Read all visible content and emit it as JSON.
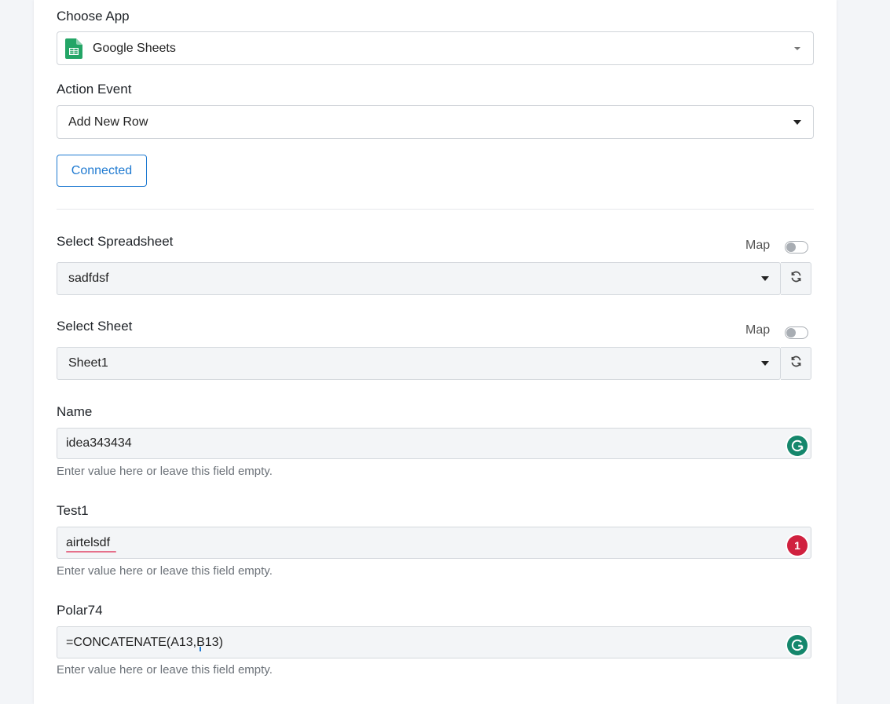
{
  "app_section": {
    "choose_app_label": "Choose App",
    "choose_app_value": "Google Sheets",
    "app_icon": "google-sheets-icon",
    "action_event_label": "Action Event",
    "action_event_value": "Add New Row",
    "connected_label": "Connected"
  },
  "spreadsheet": {
    "label": "Select Spreadsheet",
    "map_label": "Map",
    "map_on": false,
    "value": "sadfdsf",
    "refresh_icon": "refresh-icon"
  },
  "sheet": {
    "label": "Select Sheet",
    "map_label": "Map",
    "map_on": false,
    "value": "Sheet1",
    "refresh_icon": "refresh-icon"
  },
  "fields": [
    {
      "label": "Name",
      "value": "idea343434",
      "help": "Enter value here or leave this field empty.",
      "badge": "grammarly-icon"
    },
    {
      "label": "Test1",
      "value": "airtelsdf",
      "help": "Enter value here or leave this field empty.",
      "badge_count": "1"
    },
    {
      "label": "Polar74",
      "value": "=CONCATENATE(A13,B13)",
      "help": "Enter value here or leave this field empty.",
      "badge": "grammarly-icon"
    }
  ],
  "colors": {
    "accent": "#1f7ad1",
    "grammarly_green": "#15876c",
    "error_red": "#d0213f",
    "sheets_green": "#23a566"
  }
}
